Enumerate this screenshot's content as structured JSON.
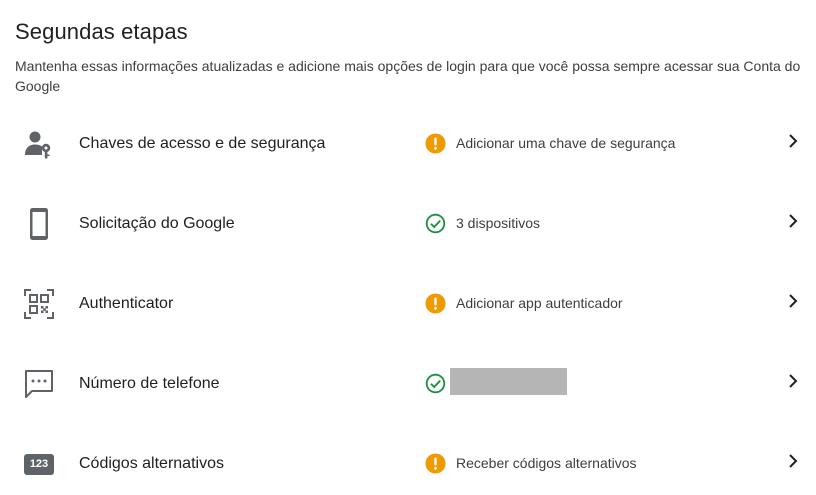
{
  "header": {
    "title": "Segundas etapas",
    "subtitle": "Mantenha essas informações atualizadas e adicione mais opções de login para que você possa sempre acessar sua Conta do Google"
  },
  "colors": {
    "warning": "#f29900",
    "success": "#1e8e3e",
    "icon": "#5f6368"
  },
  "rows": [
    {
      "label": "Chaves de acesso e de segurança",
      "icon": "person-key-icon",
      "status": "warning",
      "status_text": "Adicionar uma chave de segurança"
    },
    {
      "label": "Solicitação do Google",
      "icon": "phone-icon",
      "status": "success",
      "status_text": "3 dispositivos"
    },
    {
      "label": "Authenticator",
      "icon": "qr-code-icon",
      "status": "warning",
      "status_text": "Adicionar app autenticador"
    },
    {
      "label": "Número de telefone",
      "icon": "message-icon",
      "status": "success",
      "status_text": ""
    },
    {
      "label": "Códigos alternativos",
      "icon": "backup-codes-icon",
      "icon_text": "123",
      "status": "warning",
      "status_text": "Receber códigos alternativos"
    }
  ]
}
